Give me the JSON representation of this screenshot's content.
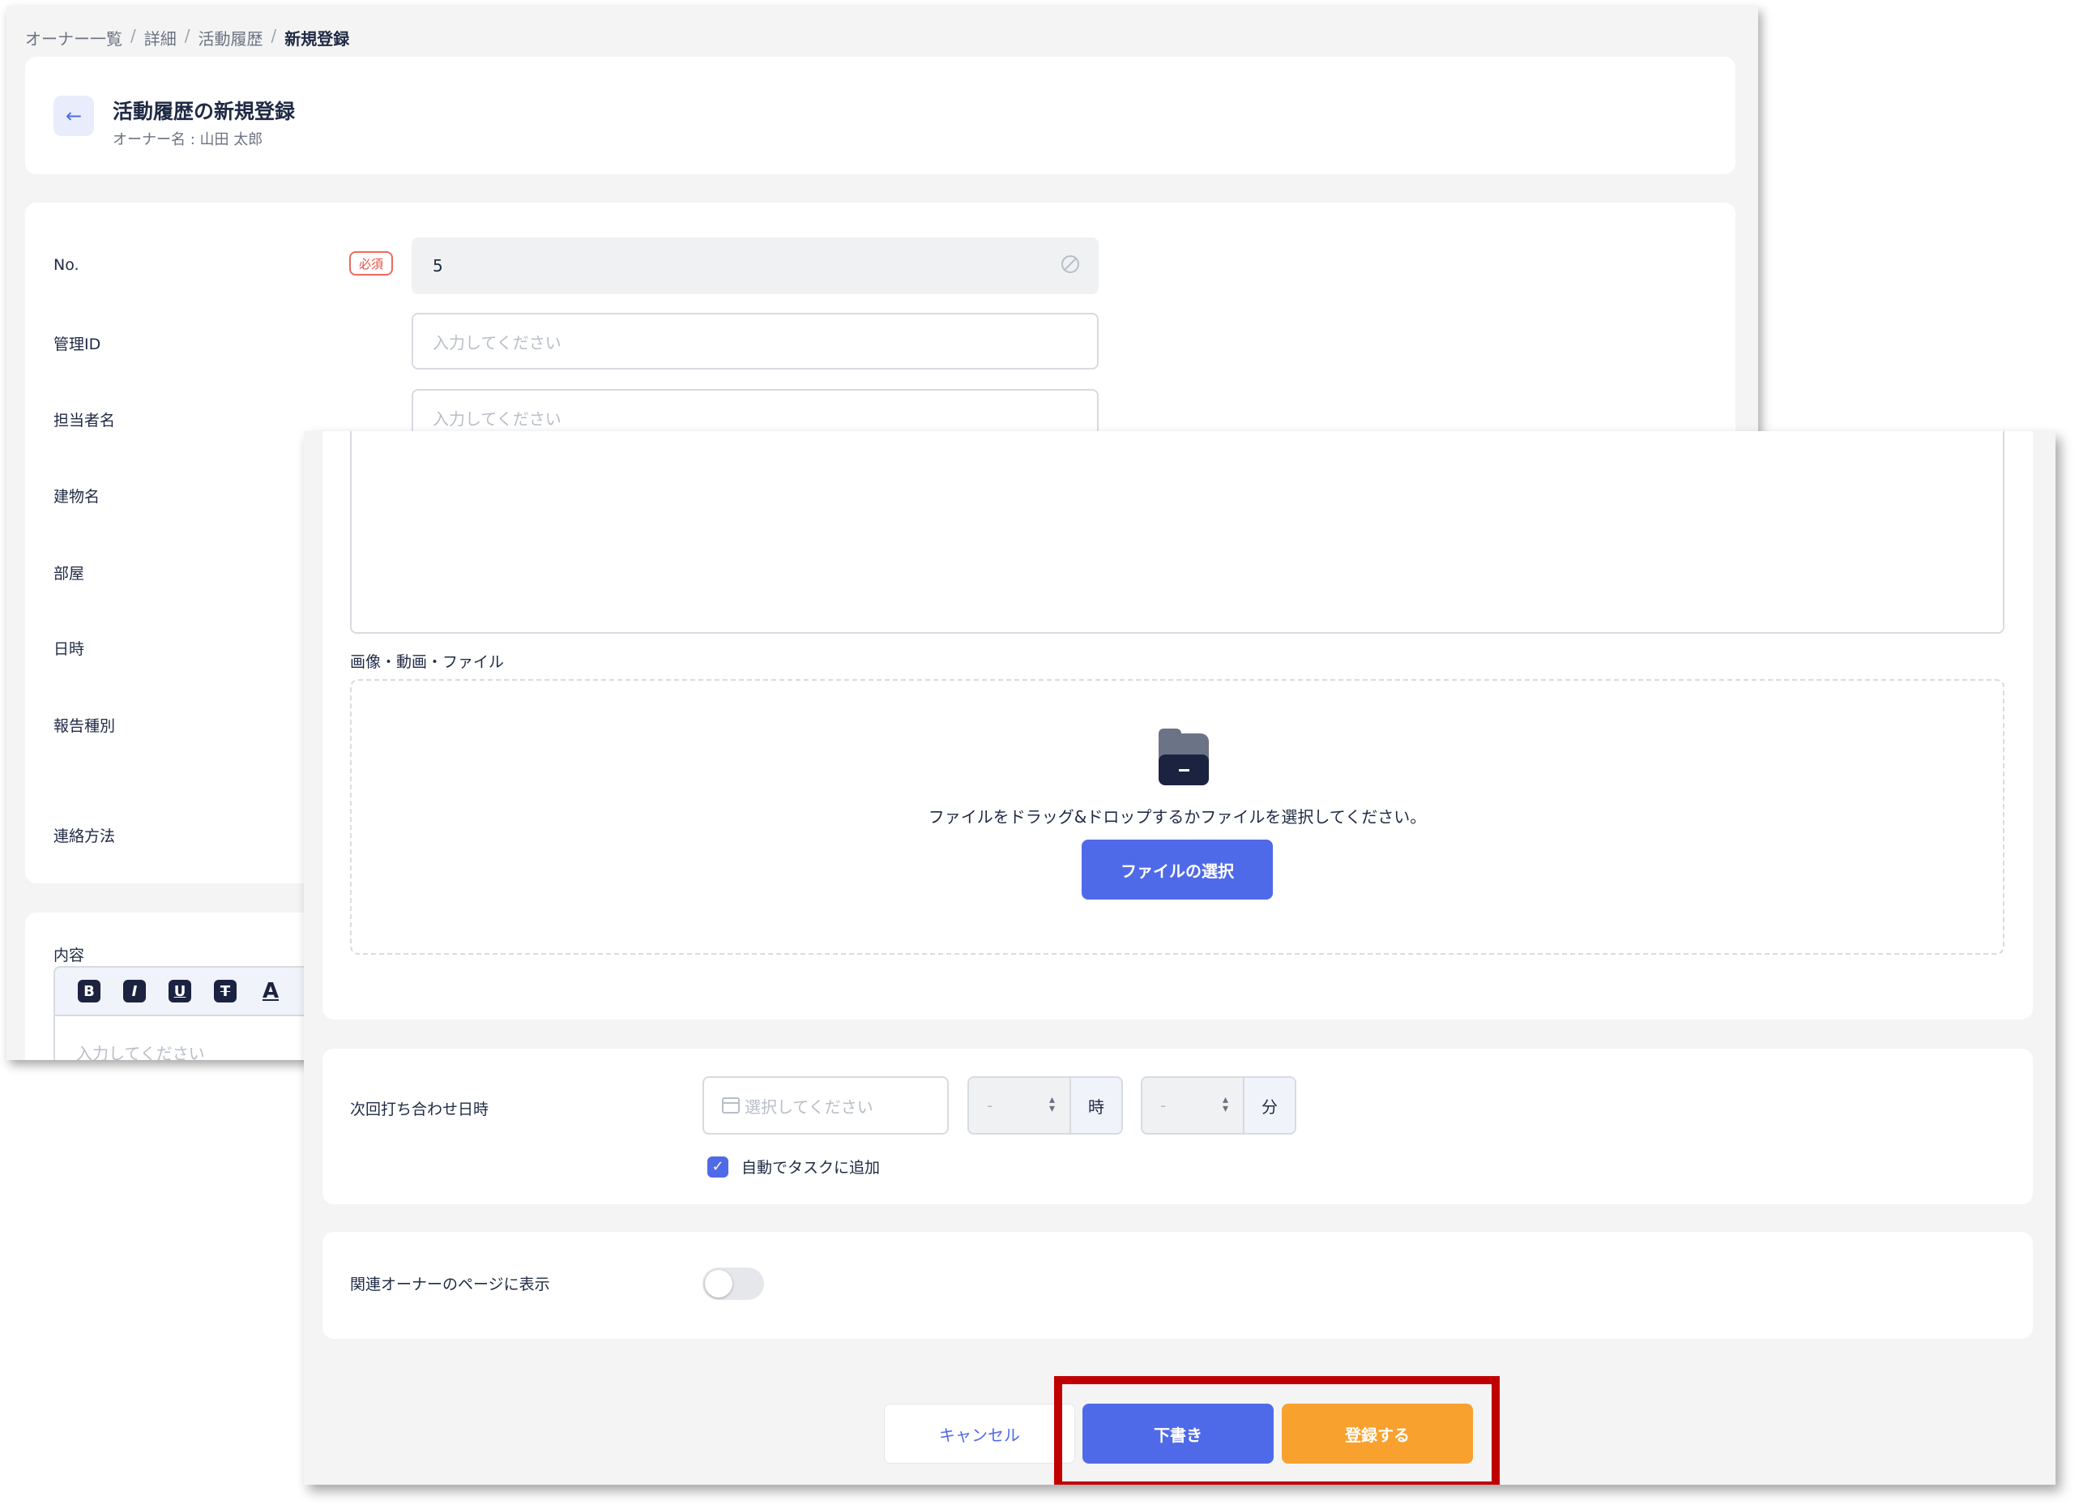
{
  "breadcrumb": [
    "オーナー一覧",
    "詳細",
    "活動履歴",
    "新規登録"
  ],
  "breadcrumb_sep": "/",
  "header": {
    "title": "活動履歴の新規登録",
    "subtitle": "オーナー名 : 山田 太郎"
  },
  "form": {
    "labels": [
      "No.",
      "管理ID",
      "担当者名",
      "建物名",
      "部屋",
      "日時",
      "報告種別",
      "連絡方法"
    ],
    "required_badge": "必須",
    "no_value": "5",
    "placeholder": "入力してください"
  },
  "content": {
    "label": "内容",
    "toolbar": [
      "B",
      "I",
      "U",
      "T",
      "A"
    ],
    "placeholder": "入力してください"
  },
  "upload": {
    "label": "画像・動画・ファイル",
    "drop_text": "ファイルをドラッグ&ドロップするかファイルを選択してください。",
    "button": "ファイルの選択"
  },
  "next_meeting": {
    "label": "次回打ち合わせ日時",
    "date_placeholder": "選択してください",
    "hour_value": "-",
    "hour_unit": "時",
    "minute_value": "-",
    "minute_unit": "分",
    "auto_task_label": "自動でタスクに追加",
    "auto_task_checked": true
  },
  "related": {
    "label": "関連オーナーのページに表示",
    "enabled": false
  },
  "actions": {
    "cancel": "キャンセル",
    "draft": "下書き",
    "submit": "登録する"
  },
  "colors": {
    "primary": "#4f6ae8",
    "submit": "#f8a12f",
    "highlight": "#c00000",
    "required": "#e05144"
  }
}
